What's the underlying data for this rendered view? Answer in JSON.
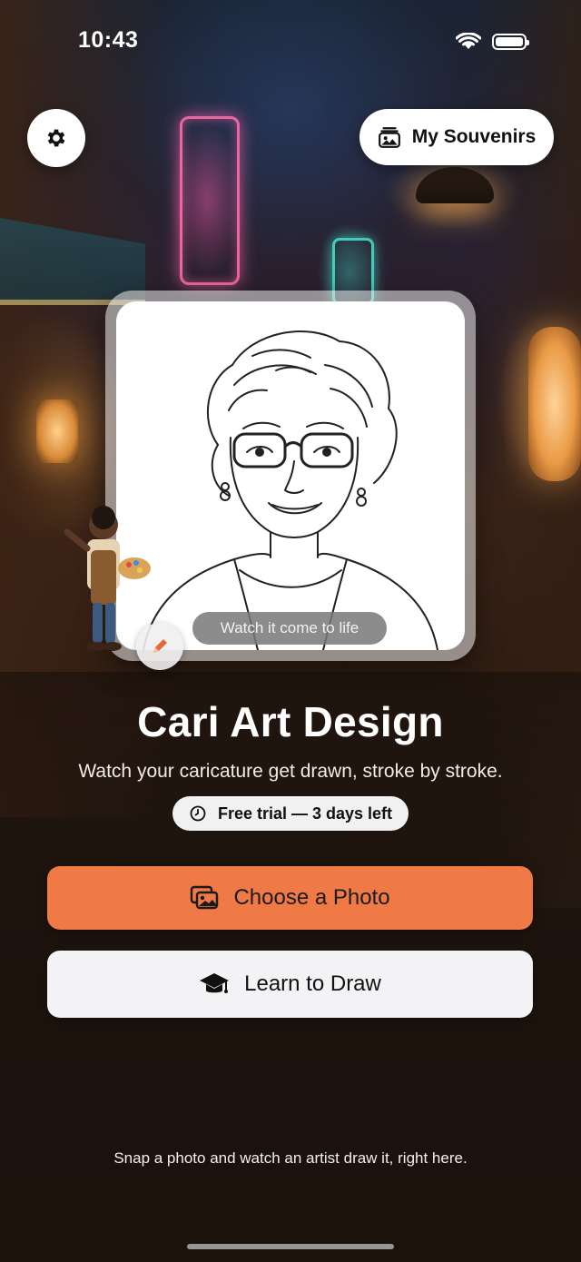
{
  "status_bar": {
    "time": "10:43",
    "wifi_icon": "wifi-icon",
    "battery_icon": "battery-icon"
  },
  "header": {
    "settings_icon": "gear-icon",
    "souvenirs_label": "My Souvenirs",
    "souvenirs_icon": "photo-album-icon"
  },
  "preview": {
    "caption": "Watch it come to life",
    "badge_icon": "pencil-icon"
  },
  "hero": {
    "title": "Cari Art Design",
    "subtitle": "Watch your caricature get drawn, stroke by stroke.",
    "trial_label": "Free trial — 3 days left",
    "trial_icon": "clock-icon"
  },
  "actions": {
    "choose_photo_label": "Choose a Photo",
    "choose_photo_icon": "photos-icon",
    "learn_label": "Learn to Draw",
    "learn_icon": "graduation-cap-icon"
  },
  "footer": {
    "note": "Snap a photo and watch an artist draw it, right here."
  },
  "colors": {
    "primary": "#ef7a46",
    "secondary": "#f3f3f6"
  }
}
